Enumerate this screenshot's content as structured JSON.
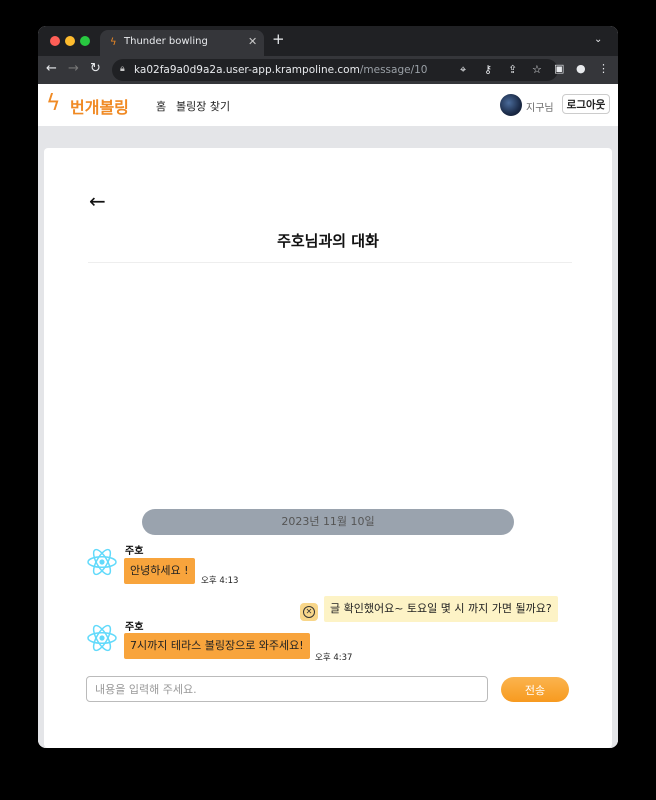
{
  "browser": {
    "tab_title": "Thunder bowling",
    "url_host": "ka02fa9a0d9a2a.user-app.krampoline.com",
    "url_path": "/message/10"
  },
  "header": {
    "logo_text": "번개볼링",
    "nav": [
      "홈",
      "볼링장 찾기"
    ],
    "user_name": "지구님",
    "logout_label": "로그아웃"
  },
  "chat": {
    "title": "주호님과의 대화",
    "date": "2023년 11월 10일",
    "messages": [
      {
        "sender": "주호",
        "text": "안녕하세요 !",
        "time": "오후 4:13",
        "side": "in"
      },
      {
        "sender": "",
        "text": "글 확인했어요~ 토요일 몇 시 까지 가면 될까요?",
        "time": "",
        "side": "out"
      },
      {
        "sender": "주호",
        "text": "7시까지 테라스 볼링장으로 와주세요!",
        "time": "오후 4:37",
        "side": "in"
      }
    ],
    "input_placeholder": "내용을 입력해 주세요.",
    "send_label": "전송"
  },
  "colors": {
    "brand": "#f08a24",
    "incoming_bubble": "#f8a43c",
    "outgoing_bubble": "#fdf3c6",
    "date_pill": "#9aa3ae"
  }
}
